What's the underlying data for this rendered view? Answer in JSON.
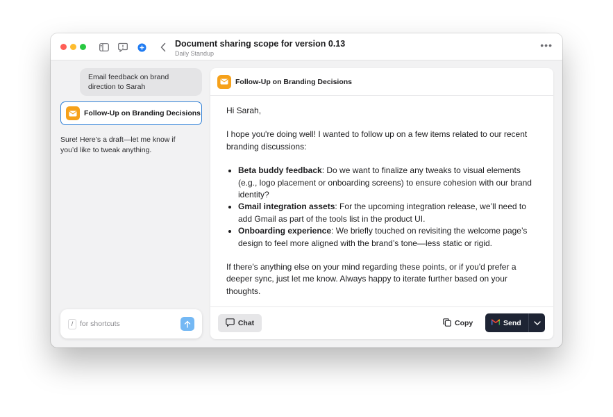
{
  "window": {
    "title": "Document sharing scope for version 0.13",
    "subtitle": "Daily Standup",
    "more_label": "•••"
  },
  "conversation": {
    "user_message": "Email feedback on brand direction to Sarah",
    "artifact_title": "Follow-Up on Branding Decisions",
    "assistant_message": "Sure! Here’s a draft—let me know if you’d like to tweak anything."
  },
  "composer": {
    "shortcut_key": "/",
    "placeholder": "for shortcuts"
  },
  "document": {
    "title": "Follow-Up on Branding Decisions",
    "greeting": "Hi Sarah,",
    "intro": "I hope you're doing well! I wanted to follow up on a few items related to our recent branding discussions:",
    "items": [
      {
        "label": "Beta buddy feedback",
        "text": ": Do we want to finalize any tweaks to visual elements (e.g., logo placement or onboarding screens) to ensure cohesion with our brand identity?"
      },
      {
        "label": "Gmail integration assets",
        "text": ": For the upcoming integration release, we’ll need to add Gmail as part of the tools list in the product UI."
      },
      {
        "label": "Onboarding experience",
        "text": ": We briefly touched on revisiting the welcome page’s design to feel more aligned with the brand’s tone—less static or rigid."
      }
    ],
    "closing": "If there's anything else on your mind regarding these points, or if you'd prefer a deeper sync, just let me know. Always happy to iterate further based on your thoughts."
  },
  "footer": {
    "chat_label": "Chat",
    "copy_label": "Copy",
    "send_label": "Send"
  },
  "colors": {
    "accent_blue": "#2f7fd6",
    "mail_orange": "#f6a11a",
    "send_dark": "#1e2434"
  }
}
